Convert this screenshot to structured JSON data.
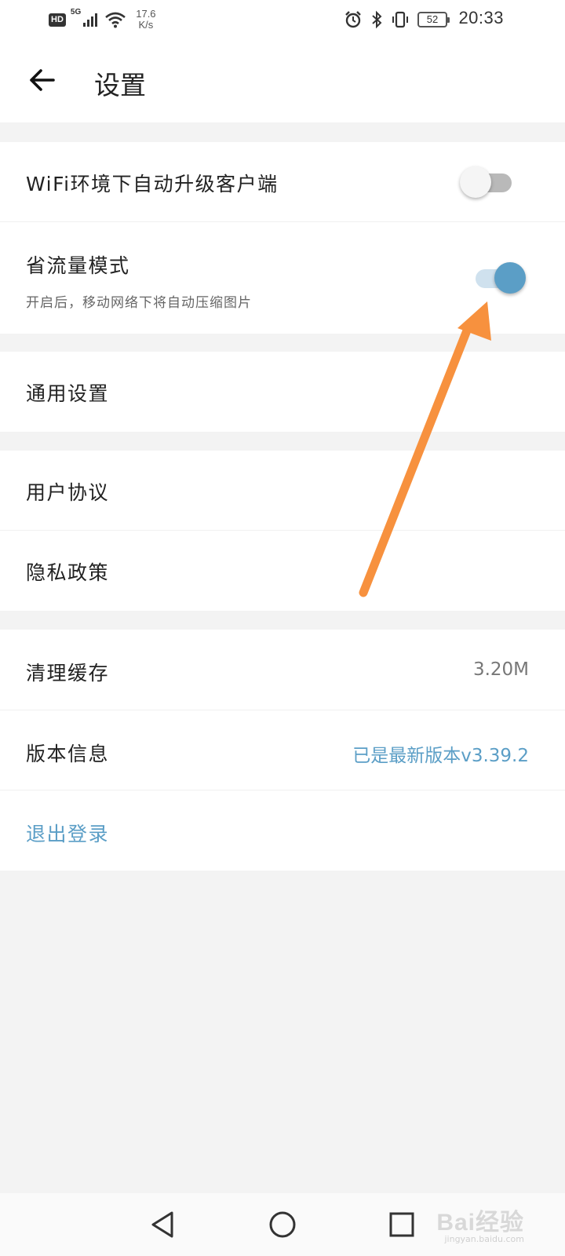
{
  "status_bar": {
    "network_badge": "HD",
    "network_type": "5G",
    "speed_value": "17.6",
    "speed_unit": "K/s",
    "battery": "52",
    "time": "20:33"
  },
  "header": {
    "title": "设置"
  },
  "settings": {
    "wifi_auto_upgrade": {
      "label": "WiFi环境下自动升级客户端",
      "enabled": false
    },
    "data_saver": {
      "label": "省流量模式",
      "description": "开启后，移动网络下将自动压缩图片",
      "enabled": true
    },
    "general": {
      "label": "通用设置"
    },
    "user_agreement": {
      "label": "用户协议"
    },
    "privacy_policy": {
      "label": "隐私政策"
    },
    "clear_cache": {
      "label": "清理缓存",
      "value": "3.20M"
    },
    "version_info": {
      "label": "版本信息",
      "value": "已是最新版本v3.39.2"
    },
    "logout": {
      "label": "退出登录"
    }
  },
  "watermark": {
    "text": "Bai经验",
    "sub": "jingyan.baidu.com"
  },
  "colors": {
    "accent": "#5b9ec6",
    "annotation_arrow": "#f7913e",
    "background": "#f3f3f3"
  }
}
